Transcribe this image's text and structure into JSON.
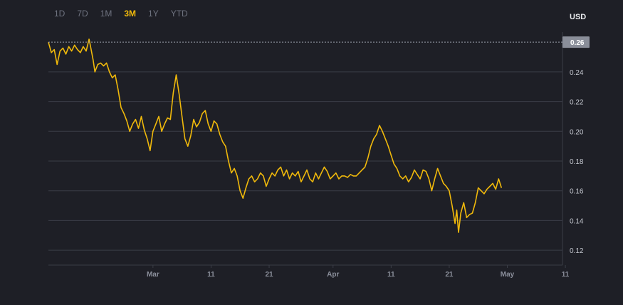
{
  "range_tabs": [
    {
      "label": "1D",
      "active": false
    },
    {
      "label": "7D",
      "active": false
    },
    {
      "label": "1M",
      "active": false
    },
    {
      "label": "3M",
      "active": true
    },
    {
      "label": "1Y",
      "active": false
    },
    {
      "label": "YTD",
      "active": false
    }
  ],
  "currency_label": "USD",
  "colors": {
    "background": "#1e1f26",
    "line": "#f0b90b",
    "grid": "#3a3d46",
    "current_price_tag": "#8a8e99"
  },
  "current_price": "0.26",
  "chart_data": {
    "type": "line",
    "title": "",
    "xlabel": "",
    "ylabel": "USD",
    "ylim": [
      0.11,
      0.262
    ],
    "y_ticks": [
      "0.12",
      "0.14",
      "0.16",
      "0.18",
      "0.20",
      "0.22",
      "0.24"
    ],
    "x_ticks": [
      {
        "label": "Mar",
        "day": 18
      },
      {
        "label": "11",
        "day": 28
      },
      {
        "label": "21",
        "day": 38
      },
      {
        "label": "Apr",
        "day": 49
      },
      {
        "label": "11",
        "day": 59
      },
      {
        "label": "21",
        "day": 69
      },
      {
        "label": "May",
        "day": 79
      },
      {
        "label": "11",
        "day": 89
      }
    ],
    "x_range_days": [
      0,
      88.5
    ],
    "grid": true,
    "series": [
      {
        "name": "",
        "points": [
          [
            0.0,
            0.26
          ],
          [
            0.5,
            0.253
          ],
          [
            1.0,
            0.255
          ],
          [
            1.5,
            0.245
          ],
          [
            2.0,
            0.254
          ],
          [
            2.5,
            0.256
          ],
          [
            3.0,
            0.252
          ],
          [
            3.5,
            0.257
          ],
          [
            4.0,
            0.254
          ],
          [
            4.5,
            0.258
          ],
          [
            5.0,
            0.255
          ],
          [
            5.5,
            0.253
          ],
          [
            6.0,
            0.257
          ],
          [
            6.5,
            0.254
          ],
          [
            7.0,
            0.262
          ],
          [
            7.3,
            0.256
          ],
          [
            7.7,
            0.248
          ],
          [
            8.0,
            0.24
          ],
          [
            8.5,
            0.245
          ],
          [
            9.0,
            0.246
          ],
          [
            9.5,
            0.244
          ],
          [
            10.0,
            0.246
          ],
          [
            10.5,
            0.24
          ],
          [
            11.0,
            0.236
          ],
          [
            11.5,
            0.238
          ],
          [
            12.0,
            0.228
          ],
          [
            12.5,
            0.216
          ],
          [
            13.0,
            0.212
          ],
          [
            13.5,
            0.207
          ],
          [
            14.0,
            0.2
          ],
          [
            14.5,
            0.205
          ],
          [
            15.0,
            0.208
          ],
          [
            15.5,
            0.202
          ],
          [
            16.0,
            0.21
          ],
          [
            16.5,
            0.201
          ],
          [
            17.0,
            0.195
          ],
          [
            17.5,
            0.187
          ],
          [
            18.0,
            0.2
          ],
          [
            18.5,
            0.205
          ],
          [
            19.0,
            0.21
          ],
          [
            19.5,
            0.2
          ],
          [
            20.0,
            0.205
          ],
          [
            20.5,
            0.209
          ],
          [
            21.0,
            0.208
          ],
          [
            21.5,
            0.226
          ],
          [
            22.0,
            0.238
          ],
          [
            22.5,
            0.225
          ],
          [
            23.0,
            0.21
          ],
          [
            23.5,
            0.195
          ],
          [
            24.0,
            0.19
          ],
          [
            24.5,
            0.197
          ],
          [
            25.0,
            0.208
          ],
          [
            25.5,
            0.203
          ],
          [
            26.0,
            0.206
          ],
          [
            26.5,
            0.212
          ],
          [
            27.0,
            0.214
          ],
          [
            27.5,
            0.205
          ],
          [
            28.0,
            0.2
          ],
          [
            28.5,
            0.207
          ],
          [
            29.0,
            0.205
          ],
          [
            29.5,
            0.198
          ],
          [
            30.0,
            0.193
          ],
          [
            30.5,
            0.19
          ],
          [
            31.0,
            0.18
          ],
          [
            31.5,
            0.172
          ],
          [
            32.0,
            0.175
          ],
          [
            32.5,
            0.17
          ],
          [
            33.0,
            0.16
          ],
          [
            33.5,
            0.155
          ],
          [
            34.0,
            0.162
          ],
          [
            34.5,
            0.168
          ],
          [
            35.0,
            0.17
          ],
          [
            35.5,
            0.166
          ],
          [
            36.0,
            0.168
          ],
          [
            36.5,
            0.172
          ],
          [
            37.0,
            0.17
          ],
          [
            37.5,
            0.163
          ],
          [
            38.0,
            0.168
          ],
          [
            38.5,
            0.172
          ],
          [
            39.0,
            0.17
          ],
          [
            39.5,
            0.174
          ],
          [
            40.0,
            0.176
          ],
          [
            40.5,
            0.17
          ],
          [
            41.0,
            0.174
          ],
          [
            41.5,
            0.168
          ],
          [
            42.0,
            0.172
          ],
          [
            42.5,
            0.17
          ],
          [
            43.0,
            0.173
          ],
          [
            43.5,
            0.166
          ],
          [
            44.0,
            0.17
          ],
          [
            44.5,
            0.174
          ],
          [
            45.0,
            0.168
          ],
          [
            45.5,
            0.166
          ],
          [
            46.0,
            0.172
          ],
          [
            46.5,
            0.168
          ],
          [
            47.0,
            0.172
          ],
          [
            47.5,
            0.176
          ],
          [
            48.0,
            0.173
          ],
          [
            48.5,
            0.168
          ],
          [
            49.0,
            0.17
          ],
          [
            49.5,
            0.172
          ],
          [
            50.0,
            0.168
          ],
          [
            50.5,
            0.17
          ],
          [
            51.0,
            0.17
          ],
          [
            51.5,
            0.169
          ],
          [
            52.0,
            0.171
          ],
          [
            52.5,
            0.17
          ],
          [
            53.0,
            0.17
          ],
          [
            53.5,
            0.172
          ],
          [
            54.0,
            0.174
          ],
          [
            54.5,
            0.176
          ],
          [
            55.0,
            0.182
          ],
          [
            55.5,
            0.19
          ],
          [
            56.0,
            0.195
          ],
          [
            56.5,
            0.198
          ],
          [
            57.0,
            0.204
          ],
          [
            57.5,
            0.2
          ],
          [
            58.0,
            0.195
          ],
          [
            58.5,
            0.19
          ],
          [
            59.0,
            0.184
          ],
          [
            59.5,
            0.178
          ],
          [
            60.0,
            0.175
          ],
          [
            60.5,
            0.17
          ],
          [
            61.0,
            0.168
          ],
          [
            61.5,
            0.17
          ],
          [
            62.0,
            0.166
          ],
          [
            62.5,
            0.169
          ],
          [
            63.0,
            0.174
          ],
          [
            63.5,
            0.171
          ],
          [
            64.0,
            0.168
          ],
          [
            64.5,
            0.174
          ],
          [
            65.0,
            0.173
          ],
          [
            65.5,
            0.168
          ],
          [
            66.0,
            0.16
          ],
          [
            66.5,
            0.168
          ],
          [
            67.0,
            0.175
          ],
          [
            67.5,
            0.17
          ],
          [
            68.0,
            0.165
          ],
          [
            68.5,
            0.163
          ],
          [
            69.0,
            0.16
          ],
          [
            69.5,
            0.15
          ],
          [
            70.0,
            0.138
          ],
          [
            70.3,
            0.147
          ],
          [
            70.6,
            0.132
          ],
          [
            71.0,
            0.145
          ],
          [
            71.5,
            0.152
          ],
          [
            72.0,
            0.142
          ],
          [
            72.5,
            0.144
          ],
          [
            73.0,
            0.145
          ],
          [
            73.5,
            0.152
          ],
          [
            74.0,
            0.162
          ],
          [
            74.5,
            0.16
          ],
          [
            75.0,
            0.158
          ],
          [
            75.5,
            0.161
          ],
          [
            76.0,
            0.163
          ],
          [
            76.5,
            0.165
          ],
          [
            77.0,
            0.161
          ],
          [
            77.5,
            0.168
          ],
          [
            78.0,
            0.162
          ]
        ]
      }
    ]
  }
}
